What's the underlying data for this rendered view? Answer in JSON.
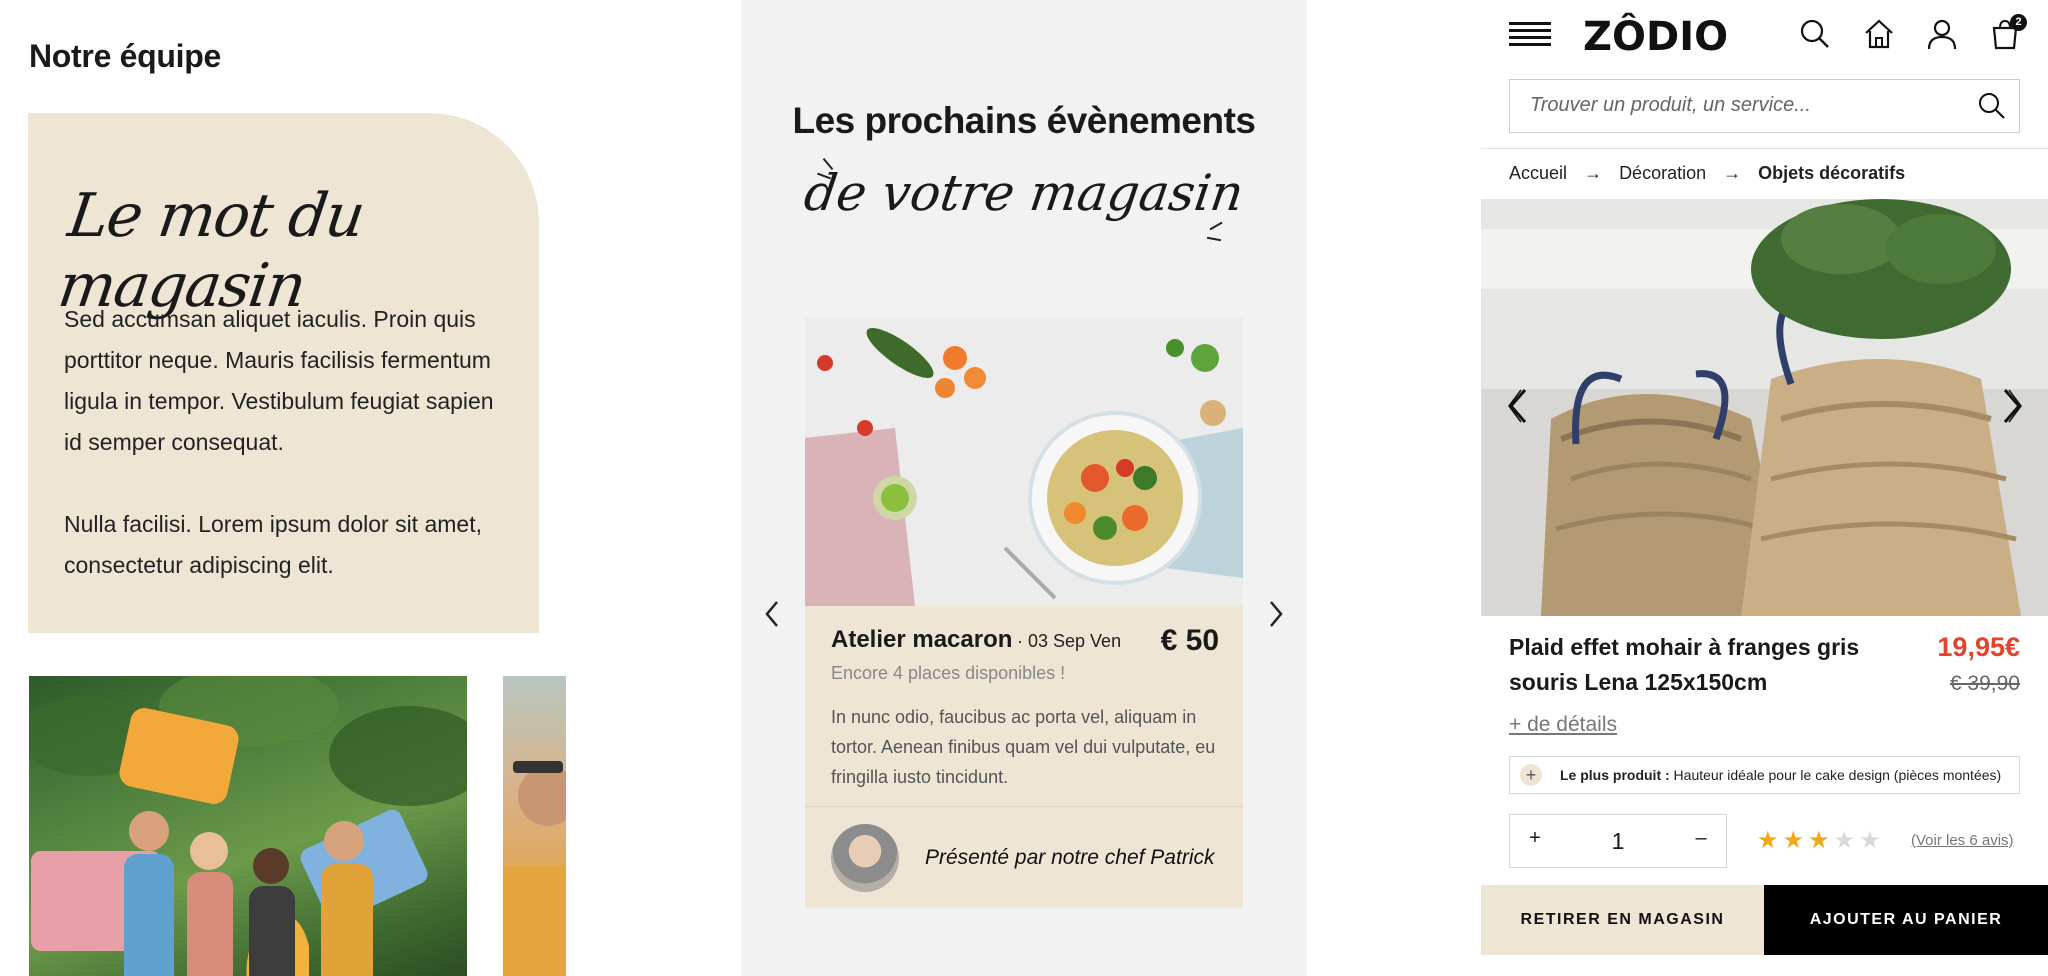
{
  "team": {
    "title": "Notre équipe",
    "card_title": "Le mot du magasin",
    "paragraph1": "Sed accumsan aliquet iaculis. Proin quis porttitor neque. Mauris facilisis fermentum ligula in tempor. Vestibulum feugiat sapien id semper consequat.",
    "paragraph2": "Nulla facilisi. Lorem ipsum dolor sit amet, consectetur adipiscing elit."
  },
  "events": {
    "title": "Les prochains évènements",
    "subtitle": "de votre magasin",
    "card": {
      "name": "Atelier macaron",
      "date": "· 03 Sep Ven",
      "price": "€ 50",
      "places": "Encore 4 places disponibles !",
      "description": "In nunc odio, faucibus ac porta vel, aliquam in tortor. Aenean finibus quam vel dui vulputate, eu fringilla iusto tincidunt.",
      "presenter": "Présenté par notre chef Patrick"
    }
  },
  "shop": {
    "logo": "ZÔDIO",
    "cart_count": "2",
    "search_placeholder": "Trouver un produit, un service...",
    "breadcrumb": [
      "Accueil",
      "Décoration",
      "Objets décoratifs"
    ],
    "breadcrumb_sep": "→",
    "product": {
      "name": "Plaid effet mohair à franges gris souris Lena 125x150cm",
      "price": "19,95€",
      "old_price": "€ 39,90",
      "more_details": "+ de détails",
      "plus_label": "Le plus produit :",
      "plus_text": "Hauteur idéale pour le cake design (pièces montées)",
      "quantity": "1",
      "rating": 3,
      "rating_max": 5,
      "reviews": "(Voir les 6 avis)"
    },
    "buttons": {
      "pickup": "RETIRER EN MAGASIN",
      "add_to_cart": "AJOUTER AU PANIER"
    },
    "colors": {
      "beige": "#efe5d5",
      "price_red": "#e4432d",
      "star_gold": "#f0a81c",
      "star_empty": "#d9d9d9"
    }
  }
}
